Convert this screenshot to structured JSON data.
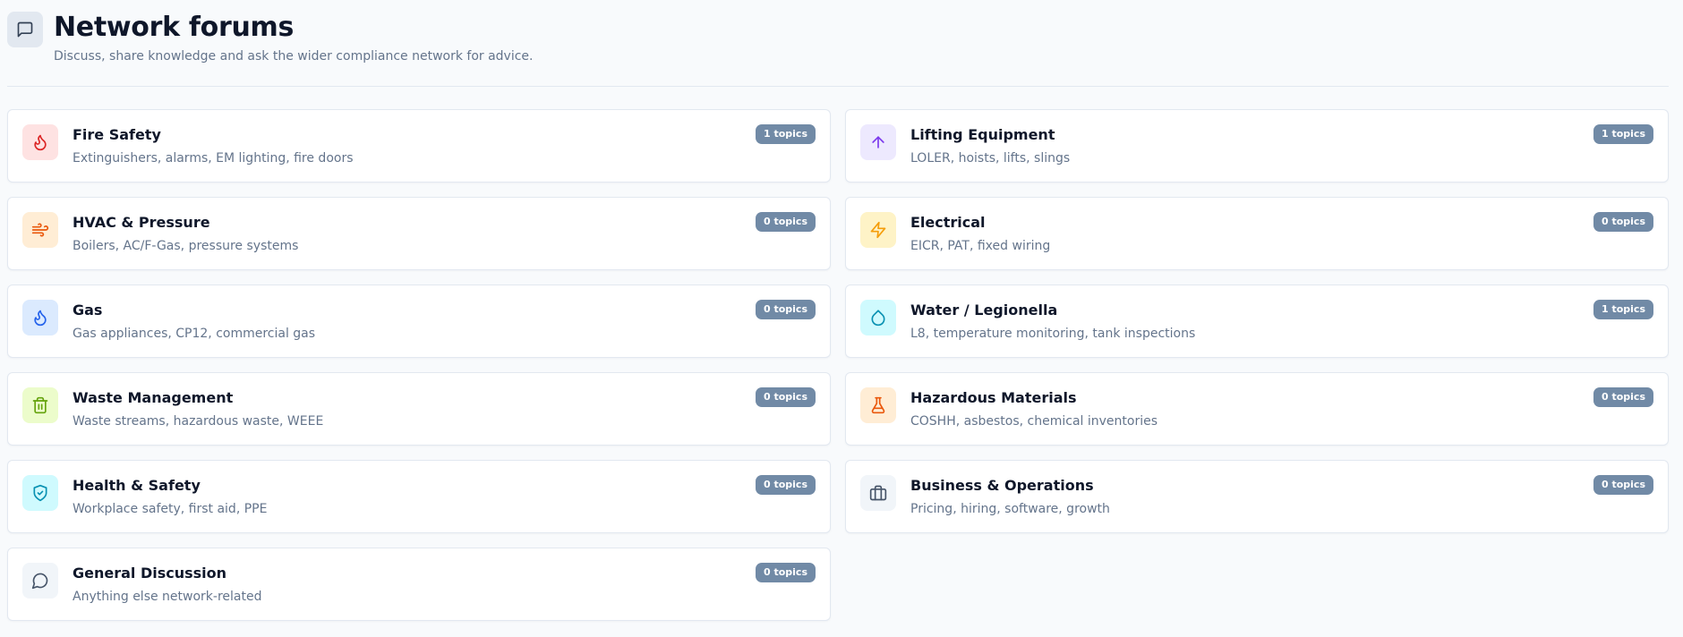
{
  "header": {
    "title": "Network forums",
    "subtitle": "Discuss, share knowledge and ask the wider compliance network for advice.",
    "icon": "message-square-icon"
  },
  "badge_suffix": "topics",
  "forums": [
    {
      "title": "Fire Safety",
      "description": "Extinguishers, alarms, EM lighting, fire doors",
      "topics": "1",
      "icon": "flame-icon",
      "color": "#dc2626",
      "bg": "#fee2e2"
    },
    {
      "title": "Lifting Equipment",
      "description": "LOLER, hoists, lifts, slings",
      "topics": "1",
      "icon": "arrow-up-icon",
      "color": "#7c3aed",
      "bg": "#ede9fe"
    },
    {
      "title": "HVAC & Pressure",
      "description": "Boilers, AC/F-Gas, pressure systems",
      "topics": "0",
      "icon": "wind-icon",
      "color": "#ea580c",
      "bg": "#ffedd5"
    },
    {
      "title": "Electrical",
      "description": "EICR, PAT, fixed wiring",
      "topics": "0",
      "icon": "zap-icon",
      "color": "#f59e0b",
      "bg": "#fef3c7"
    },
    {
      "title": "Gas",
      "description": "Gas appliances, CP12, commercial gas",
      "topics": "0",
      "icon": "gas-flame-icon",
      "color": "#2563eb",
      "bg": "#dbeafe"
    },
    {
      "title": "Water / Legionella",
      "description": "L8, temperature monitoring, tank inspections",
      "topics": "1",
      "icon": "droplet-icon",
      "color": "#0891b2",
      "bg": "#cffafe"
    },
    {
      "title": "Waste Management",
      "description": "Waste streams, hazardous waste, WEEE",
      "topics": "0",
      "icon": "trash-icon",
      "color": "#65a30d",
      "bg": "#ecfccb"
    },
    {
      "title": "Hazardous Materials",
      "description": "COSHH, asbestos, chemical inventories",
      "topics": "0",
      "icon": "flask-icon",
      "color": "#ea580c",
      "bg": "#ffedd5"
    },
    {
      "title": "Health & Safety",
      "description": "Workplace safety, first aid, PPE",
      "topics": "0",
      "icon": "shield-check-icon",
      "color": "#0891b2",
      "bg": "#cffafe"
    },
    {
      "title": "Business & Operations",
      "description": "Pricing, hiring, software, growth",
      "topics": "0",
      "icon": "briefcase-icon",
      "color": "#475569",
      "bg": "#f1f5f9"
    },
    {
      "title": "General Discussion",
      "description": "Anything else network-related",
      "topics": "0",
      "icon": "message-circle-icon",
      "color": "#475569",
      "bg": "#f1f5f9"
    }
  ]
}
